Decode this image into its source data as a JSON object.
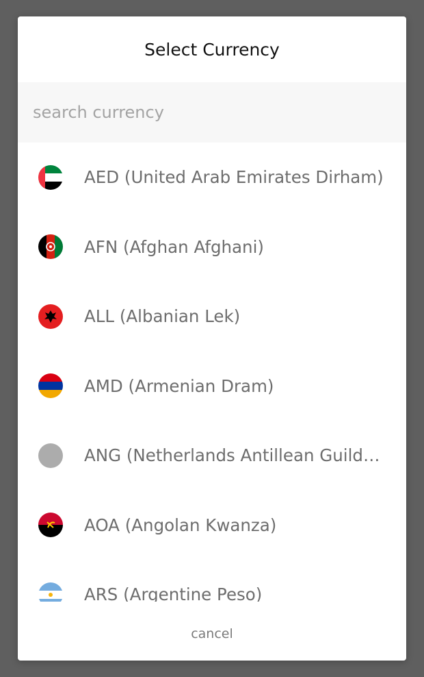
{
  "modal": {
    "title": "Select Currency",
    "search": {
      "placeholder": "search currency",
      "value": ""
    },
    "cancel_label": "cancel"
  },
  "currencies": [
    {
      "label": "AED (United Arab Emirates Dirham)",
      "flag_icon": "uae-flag-icon"
    },
    {
      "label": "AFN (Afghan Afghani)",
      "flag_icon": "afghanistan-flag-icon"
    },
    {
      "label": "ALL (Albanian Lek)",
      "flag_icon": "albania-flag-icon"
    },
    {
      "label": "AMD (Armenian Dram)",
      "flag_icon": "armenia-flag-icon"
    },
    {
      "label": "ANG (Netherlands Antillean Guilder)",
      "flag_icon": "placeholder-flag-icon"
    },
    {
      "label": "AOA (Angolan Kwanza)",
      "flag_icon": "angola-flag-icon"
    },
    {
      "label": "ARS (Argentine Peso)",
      "flag_icon": "argentina-flag-icon"
    }
  ],
  "colors": {
    "overlay": "#5f5f5f",
    "modal_bg": "#ffffff",
    "search_bg": "#f7f7f7",
    "item_text": "#6d6d6d",
    "placeholder_text": "#a3a3a3"
  }
}
